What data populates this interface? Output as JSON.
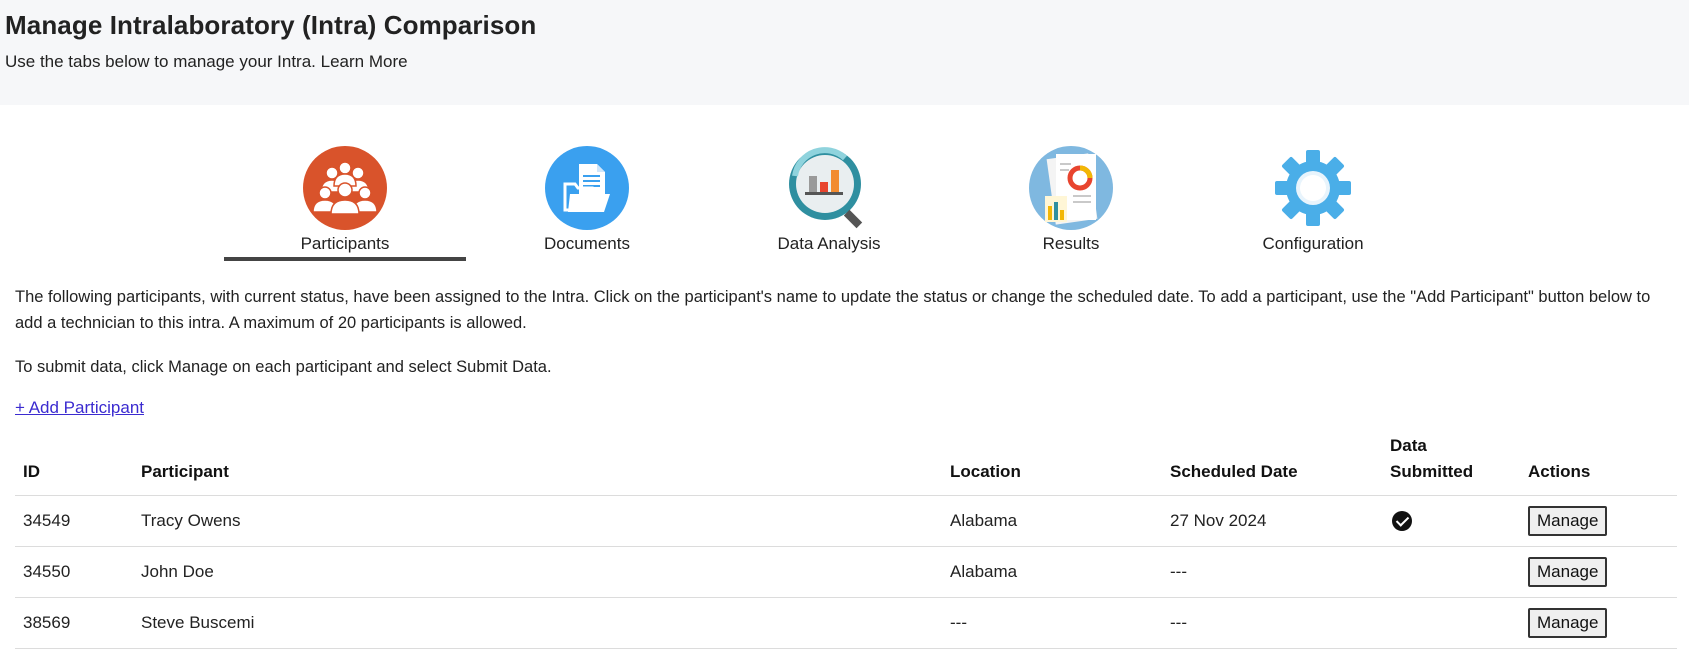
{
  "header": {
    "title": "Manage Intralaboratory (Intra) Comparison",
    "subtitle": "Use the tabs below to manage your Intra.",
    "learn_more": "Learn More"
  },
  "tabs": [
    {
      "label": "Participants",
      "icon": "participants-group-icon",
      "active": true
    },
    {
      "label": "Documents",
      "icon": "folder-documents-icon",
      "active": false
    },
    {
      "label": "Data Analysis",
      "icon": "chart-magnifier-icon",
      "active": false
    },
    {
      "label": "Results",
      "icon": "report-results-icon",
      "active": false
    },
    {
      "label": "Configuration",
      "icon": "gear-icon",
      "active": false
    }
  ],
  "main": {
    "description": "The following participants, with current status, have been assigned to the Intra. Click on the participant's name to update the status or change the scheduled date. To add a participant, use the \"Add Participant\" button below to add a technician to this intra. A maximum of 20 participants is allowed.",
    "submit_instructions": "To submit data, click Manage on each participant and select Submit Data.",
    "add_participant": "+ Add Participant"
  },
  "table": {
    "headers": {
      "id": "ID",
      "participant": "Participant",
      "location": "Location",
      "scheduled_date": "Scheduled Date",
      "data_submitted": "Data Submitted",
      "actions": "Actions"
    },
    "rows": [
      {
        "id": "34549",
        "participant": "Tracy Owens",
        "location": "Alabama",
        "scheduled_date": "27 Nov 2024",
        "data_submitted": true,
        "action": "Manage"
      },
      {
        "id": "34550",
        "participant": "John Doe",
        "location": "Alabama",
        "scheduled_date": "---",
        "data_submitted": false,
        "action": "Manage"
      },
      {
        "id": "38569",
        "participant": "Steve Buscemi",
        "location": "---",
        "scheduled_date": "---",
        "data_submitted": false,
        "action": "Manage"
      }
    ]
  },
  "colors": {
    "participants_icon": "#d9532b",
    "documents_icon": "#3aa0ef",
    "analysis_icon": "#2f8fa0",
    "results_icon": "#7fb8e0",
    "config_icon": "#4aaee8",
    "link": "#3b2bd0",
    "active_underline": "#444444"
  }
}
